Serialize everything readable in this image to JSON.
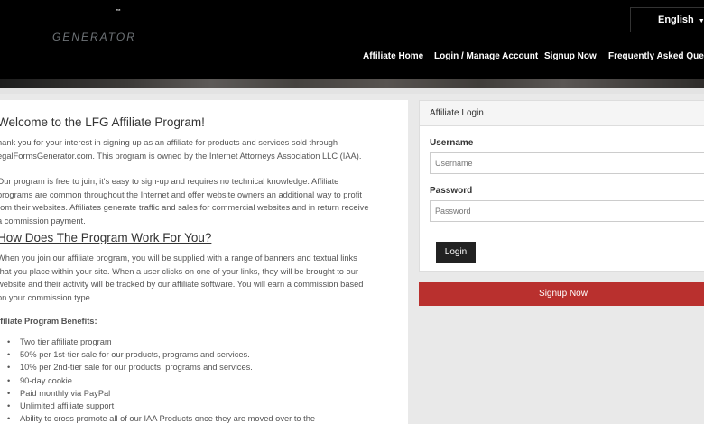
{
  "header": {
    "tm": "™",
    "logo_text": "GENERATOR",
    "language": "English",
    "nav": [
      "Affiliate Home",
      "Login / Manage Account",
      "Signup Now",
      "Frequently Asked Questions"
    ]
  },
  "content": {
    "welcome_title": "Welcome to the LFG Affiliate Program!",
    "intro_lines": [
      "hank you for your interest in signing up as an affiliate for products and services sold through",
      "egalFormsGenerator.com. This program is owned by the Internet Attorneys Association LLC (IAA)."
    ],
    "program_lines": [
      "Our program is free to join, it's easy to sign-up and requires no technical knowledge. Affiliate",
      "programs are common throughout the Internet and offer website owners an additional way to profit",
      "rom their websites. Affiliates generate traffic and sales for commercial websites and in return receive",
      "a commission payment."
    ],
    "how_title": "How Does The Program Work For You?",
    "how_lines": [
      "When you join our affiliate program, you will be supplied with a range of banners and textual links",
      "that you place within your site. When a user clicks on one of your links, they will be brought to our",
      "website and their activity will be tracked by our affiliate software. You will earn a commission based",
      "on your commission type."
    ],
    "benefits_title": "ffiliate Program Benefits:",
    "benefits": [
      "Two tier affiliate program",
      "50% per 1st-tier sale for our products, programs and services.",
      "10% per 2nd-tier sale for our products, programs and services.",
      "90-day cookie",
      "Paid monthly via PayPal",
      "Unlimited affiliate support",
      "Ability to cross promote all of our IAA Products once they are moved over to the"
    ]
  },
  "login": {
    "panel_title": "Affiliate Login",
    "username_label": "Username",
    "username_placeholder": "Username",
    "password_label": "Password",
    "password_placeholder": "Password",
    "login_button": "Login"
  },
  "signup_button": "Signup Now",
  "colors": {
    "header_bg": "#000000",
    "signup_red": "#b9302e",
    "login_btn": "#222222"
  }
}
